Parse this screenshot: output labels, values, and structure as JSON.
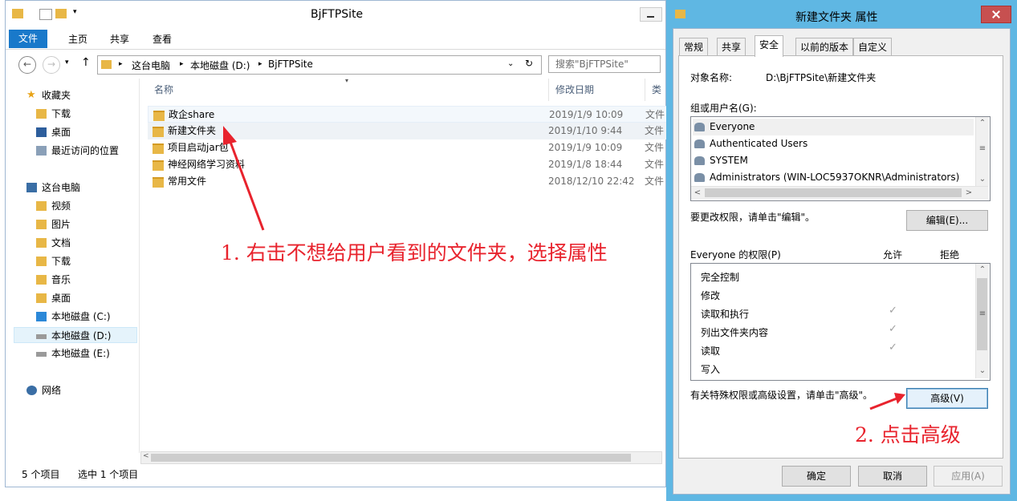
{
  "explorer": {
    "title": "BjFTPSite",
    "ribbon_tabs": [
      "文件",
      "主页",
      "共享",
      "查看"
    ],
    "address": {
      "crumbs": [
        "这台电脑",
        "本地磁盘 (D:)",
        "BjFTPSite"
      ],
      "search_placeholder": "搜索\"BjFTPSite\""
    },
    "nav": {
      "favorites_label": "收藏夹",
      "favorites": [
        "下载",
        "桌面",
        "最近访问的位置"
      ],
      "pc_label": "这台电脑",
      "pc_items": [
        "视频",
        "图片",
        "文档",
        "下载",
        "音乐",
        "桌面",
        "本地磁盘 (C:)",
        "本地磁盘 (D:)",
        "本地磁盘 (E:)"
      ],
      "network_label": "网络"
    },
    "columns": {
      "name": "名称",
      "date": "修改日期",
      "type": "类型"
    },
    "files": [
      {
        "name": "政企share",
        "date": "2019/1/9 10:09",
        "type": "文件"
      },
      {
        "name": "新建文件夹",
        "date": "2019/1/10 9:44",
        "type": "文件"
      },
      {
        "name": "项目启动jar包",
        "date": "2019/1/9 10:09",
        "type": "文件"
      },
      {
        "name": "神经网络学习资料",
        "date": "2019/1/8 18:44",
        "type": "文件"
      },
      {
        "name": "常用文件",
        "date": "2018/12/10 22:42",
        "type": "文件"
      }
    ],
    "status": {
      "count": "5 个项目",
      "selected": "选中 1 个项目"
    }
  },
  "dialog": {
    "title": "新建文件夹 属性",
    "tabs": [
      "常规",
      "共享",
      "安全",
      "以前的版本",
      "自定义"
    ],
    "object_label": "对象名称:",
    "object_value": "D:\\BjFTPSite\\新建文件夹",
    "group_label": "组或用户名(G):",
    "users": [
      "Everyone",
      "Authenticated Users",
      "SYSTEM",
      "Administrators (WIN-LOC5937OKNR\\Administrators)"
    ],
    "edit_hint": "要更改权限，请单击\"编辑\"。",
    "edit_button": "编辑(E)...",
    "perm_label": "Everyone 的权限(P)",
    "allow_label": "允许",
    "deny_label": "拒绝",
    "permissions": [
      "完全控制",
      "修改",
      "读取和执行",
      "列出文件夹内容",
      "读取",
      "写入"
    ],
    "advanced_hint": "有关特殊权限或高级设置，请单击\"高级\"。",
    "advanced_button": "高级(V)",
    "ok_button": "确定",
    "cancel_button": "取消",
    "apply_button": "应用(A)"
  },
  "annotations": {
    "step1": "1. 右击不想给用户看到的文件夹，选择属性",
    "step2": "2. 点击高级",
    "color": "#e8232d"
  }
}
